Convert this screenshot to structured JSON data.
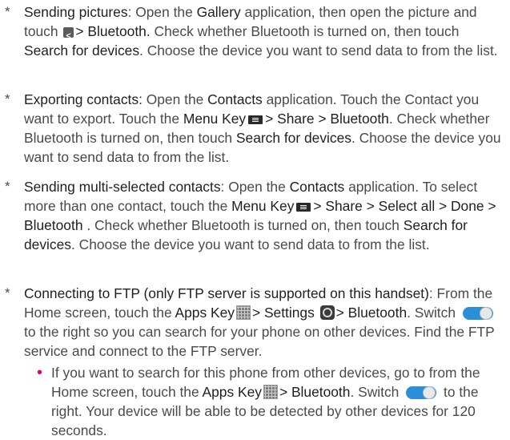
{
  "bullet_star": "*",
  "bullet_dot": "•",
  "icons": {
    "share": "share-icon",
    "menu": "menu-key-icon",
    "apps": "apps-key-icon",
    "settings": "settings-gear-icon",
    "toggle": "bluetooth-switch-icon"
  },
  "colors": {
    "bold_text": "#1f1f1f",
    "body_text": "#4a4a4a",
    "sub_bullet": "#e0007a",
    "toggle": "#2a8fd6"
  },
  "item1": {
    "heading": "Sending pictures",
    "t1": ": Open the ",
    "gallery": "Gallery",
    "t2": " application, then open the picture and touch ",
    "bt": "> Bluetooth.",
    "t3": " Check whether Bluetooth is turned on, then touch ",
    "search": "Search for devices",
    "t4": ". Choose the device you want to send data to from the list."
  },
  "item2": {
    "heading": "Exporting contacts:",
    "t1": " Open the ",
    "contacts": "Contacts",
    "t2": " application. Touch the Contact you want to export. Touch the ",
    "menu_key": "Menu Key",
    "share_bt": "> Share > Bluetooth",
    "t3": ". Check whether Bluetooth is turned on, then touch ",
    "search": "Search for devices",
    "t4": ". Choose the device you want to send data to from the list."
  },
  "item3": {
    "heading": "Sending multi-selected contacts",
    "t1": ": Open the ",
    "contacts": "Contacts",
    "t2": " application. To select more than one contact, touch the ",
    "menu_key": "Menu Key",
    "path": "> Share > Select all > Done > Bluetooth",
    "t3": " . Check whether Bluetooth is turned on, then touch ",
    "search": "Search for devices",
    "t4": ". Choose the device you want to send data to from the list."
  },
  "item4": {
    "heading": "Connecting to FTP (only FTP server is supported on this handset)",
    "t1": ": From the Home screen, touch the ",
    "apps_key": "Apps Key",
    "settings": "> Settings",
    "arrow": ">",
    "bluetooth": "Bluetooth",
    "t2": ". Switch ",
    "t3": " to the right so you can search for your phone on other devices. Find the FTP service and connect to the FTP server."
  },
  "sub1": {
    "t1": "If you want to search for this phone from other devices, go to from the Home screen, touch the ",
    "apps_key": "Apps Key",
    "bluetooth": "> Bluetooth",
    "t2": ". Switch ",
    "t3": " to the right. Your device will be able to be detected by other devices for 120 seconds."
  }
}
